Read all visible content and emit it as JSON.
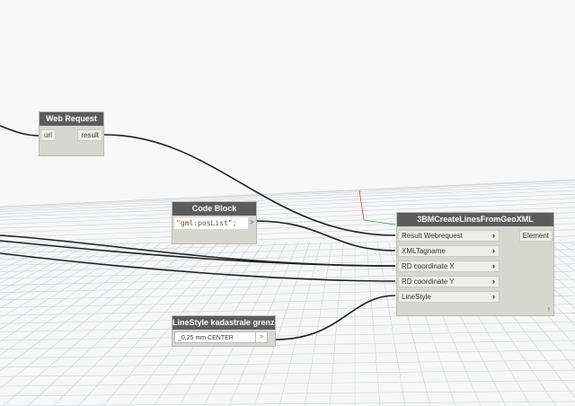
{
  "nodes": {
    "web_request": {
      "title": "Web Request",
      "input": "url",
      "output": "result"
    },
    "code_block": {
      "title": "Code Block",
      "code": "\"gml:posList\";",
      "output_arrow": ">"
    },
    "linestyle": {
      "title": "LineStyle kadastrale grenzen",
      "selected": "_0,25 mm CENTER",
      "dropdown_arrow": ">"
    },
    "create_lines": {
      "title": "3BMCreateLinesFromGeoXML",
      "inputs": [
        "Result Webrequest",
        "XMLTagname",
        "RD coordinate X",
        "RD coordinate Y",
        "LineStyle"
      ],
      "output": "Element",
      "footer_mark": "!"
    }
  },
  "colors": {
    "background": "#f7f7f7",
    "grid": "#c7d0d6",
    "wire": "#1e1e1e",
    "node_header": "#5c5c5c",
    "node_body": "#d7d7d2"
  }
}
